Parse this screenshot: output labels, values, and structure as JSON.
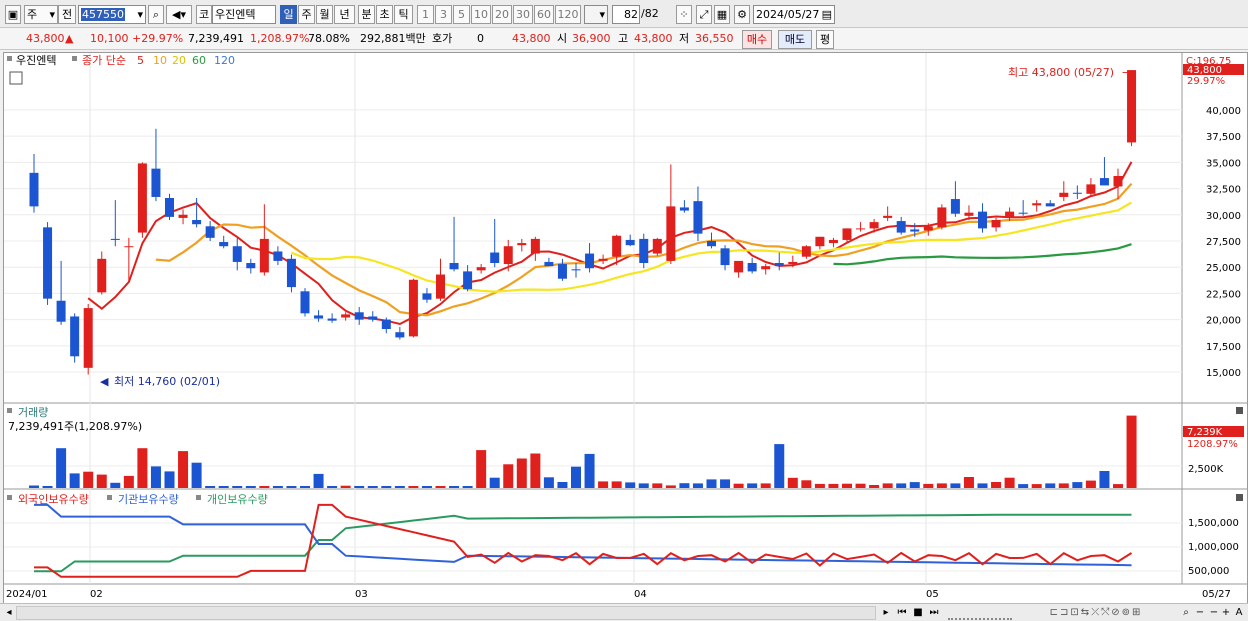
{
  "toolbar": {
    "market": "주",
    "prev": "전",
    "code": "457550",
    "kind": "코",
    "name": "우진엔텍",
    "periods": [
      "일",
      "주",
      "월",
      "년",
      "분",
      "초",
      "틱"
    ],
    "minutes": [
      "1",
      "3",
      "5",
      "10",
      "20",
      "30",
      "60",
      "120"
    ],
    "count": "82",
    "count_total": "/82",
    "date": "2024/05/27"
  },
  "info": {
    "price": "43,800",
    "change": "10,100",
    "change_pct": "+29.97%",
    "volume": "7,239,491",
    "volume_pct": "1,208.97%",
    "turnover": "78.08%",
    "amount": "292,881백만",
    "hoga_label": "호가",
    "hoga_value": "0",
    "hoga_price": "43,800",
    "open_label": "시",
    "open": "36,900",
    "high_label": "고",
    "high": "43,800",
    "low_label": "저",
    "low": "36,550",
    "buy": "매수",
    "sell": "매도",
    "avg": "평"
  },
  "price_panel": {
    "name": "우진엔텍",
    "ma_label": "종가 단순",
    "ma_periods": [
      "5",
      "10",
      "20",
      "60",
      "120"
    ],
    "ma_colors": [
      "#e0201c",
      "#f0a020",
      "#f0d020",
      "#2a9a40",
      "#3a7ad8"
    ],
    "ticks": [
      "40,000",
      "37,500",
      "35,000",
      "32,500",
      "30,000",
      "27,500",
      "25,000",
      "22,500",
      "20,000",
      "17,500",
      "15,000"
    ],
    "top_tick": "C:196.75",
    "current_tag": "43,800",
    "pct_tag": "29.97%",
    "high_annotation": "최고 43,800 (05/27)",
    "low_annotation": "최저 14,760 (02/01)"
  },
  "volume_panel": {
    "title": "거래량",
    "sub": "7,239,491주(1,208.97%)",
    "tick": "2,500K",
    "tag": "7,239K",
    "tag_pct": "1208.97%"
  },
  "holding_panel": {
    "legend": [
      {
        "label": "외국인보유수량",
        "color": "#e0201c"
      },
      {
        "label": "기관보유수량",
        "color": "#2f62d8"
      },
      {
        "label": "개인보유수량",
        "color": "#2a9a60"
      }
    ],
    "ticks": [
      "1,500,000",
      "1,000,000",
      "500,000"
    ]
  },
  "xaxis": {
    "labels": [
      "2024/01",
      "02",
      "03",
      "04",
      "05",
      "05/27"
    ]
  },
  "chart_data": {
    "type": "candlestick",
    "period": "daily",
    "y_range": [
      13000,
      44000
    ],
    "candles": [
      {
        "o": 34000,
        "h": 35800,
        "l": 30200,
        "c": 30800
      },
      {
        "o": 28800,
        "h": 29300,
        "l": 21400,
        "c": 22000
      },
      {
        "o": 21800,
        "h": 25600,
        "l": 19500,
        "c": 19800
      },
      {
        "o": 20300,
        "h": 20600,
        "l": 15900,
        "c": 16500
      },
      {
        "o": 15400,
        "h": 21500,
        "l": 14760,
        "c": 21100
      },
      {
        "o": 22600,
        "h": 26500,
        "l": 22400,
        "c": 25800
      },
      {
        "o": 27700,
        "h": 31400,
        "l": 27000,
        "c": 27600
      },
      {
        "o": 27000,
        "h": 27800,
        "l": 23600,
        "c": 27000
      },
      {
        "o": 28300,
        "h": 35000,
        "l": 27800,
        "c": 34900
      },
      {
        "o": 34400,
        "h": 38200,
        "l": 31300,
        "c": 31700
      },
      {
        "o": 31600,
        "h": 32000,
        "l": 29500,
        "c": 29800
      },
      {
        "o": 29700,
        "h": 30500,
        "l": 29100,
        "c": 30000
      },
      {
        "o": 29500,
        "h": 31600,
        "l": 28800,
        "c": 29100
      },
      {
        "o": 28900,
        "h": 29400,
        "l": 27500,
        "c": 27800
      },
      {
        "o": 27400,
        "h": 28000,
        "l": 26800,
        "c": 27000
      },
      {
        "o": 27000,
        "h": 27800,
        "l": 24700,
        "c": 25500
      },
      {
        "o": 25400,
        "h": 25800,
        "l": 24400,
        "c": 24900
      },
      {
        "o": 24500,
        "h": 31000,
        "l": 24200,
        "c": 27700
      },
      {
        "o": 26500,
        "h": 27000,
        "l": 25200,
        "c": 25600
      },
      {
        "o": 25800,
        "h": 26200,
        "l": 22600,
        "c": 23100
      },
      {
        "o": 22700,
        "h": 23000,
        "l": 20300,
        "c": 20600
      },
      {
        "o": 20400,
        "h": 20900,
        "l": 19800,
        "c": 20100
      },
      {
        "o": 20100,
        "h": 20600,
        "l": 19700,
        "c": 19900
      },
      {
        "o": 20200,
        "h": 20700,
        "l": 19900,
        "c": 20500
      },
      {
        "o": 20700,
        "h": 21200,
        "l": 19500,
        "c": 20000
      },
      {
        "o": 20300,
        "h": 20800,
        "l": 19800,
        "c": 20000
      },
      {
        "o": 20000,
        "h": 20200,
        "l": 18700,
        "c": 19100
      },
      {
        "o": 18800,
        "h": 19300,
        "l": 18100,
        "c": 18300
      },
      {
        "o": 18400,
        "h": 23900,
        "l": 18300,
        "c": 23800
      },
      {
        "o": 22500,
        "h": 23000,
        "l": 21600,
        "c": 21900
      },
      {
        "o": 22000,
        "h": 25800,
        "l": 21800,
        "c": 24300
      },
      {
        "o": 25400,
        "h": 29800,
        "l": 24600,
        "c": 24800
      },
      {
        "o": 24600,
        "h": 25200,
        "l": 22700,
        "c": 22900
      },
      {
        "o": 24700,
        "h": 25300,
        "l": 24400,
        "c": 25000
      },
      {
        "o": 26400,
        "h": 29600,
        "l": 25000,
        "c": 25400
      },
      {
        "o": 25300,
        "h": 27600,
        "l": 24600,
        "c": 27000
      },
      {
        "o": 27100,
        "h": 27700,
        "l": 26500,
        "c": 27300
      },
      {
        "o": 26300,
        "h": 27900,
        "l": 25600,
        "c": 27700
      },
      {
        "o": 25500,
        "h": 25900,
        "l": 25100,
        "c": 25100
      },
      {
        "o": 25300,
        "h": 25800,
        "l": 23700,
        "c": 23900
      },
      {
        "o": 24800,
        "h": 25400,
        "l": 24000,
        "c": 24700
      },
      {
        "o": 26300,
        "h": 27300,
        "l": 24500,
        "c": 24900
      },
      {
        "o": 25600,
        "h": 26200,
        "l": 25300,
        "c": 25800
      },
      {
        "o": 26000,
        "h": 28100,
        "l": 25200,
        "c": 28000
      },
      {
        "o": 27600,
        "h": 28100,
        "l": 27000,
        "c": 27100
      },
      {
        "o": 27700,
        "h": 28200,
        "l": 24900,
        "c": 25400
      },
      {
        "o": 26300,
        "h": 27800,
        "l": 26100,
        "c": 27700
      },
      {
        "o": 25600,
        "h": 34800,
        "l": 25300,
        "c": 30800
      },
      {
        "o": 30700,
        "h": 31400,
        "l": 30200,
        "c": 30400
      },
      {
        "o": 31300,
        "h": 32700,
        "l": 27500,
        "c": 28200
      },
      {
        "o": 27500,
        "h": 28300,
        "l": 26800,
        "c": 27000
      },
      {
        "o": 26800,
        "h": 27100,
        "l": 24700,
        "c": 25200
      },
      {
        "o": 24500,
        "h": 25500,
        "l": 24000,
        "c": 25600
      },
      {
        "o": 25400,
        "h": 25900,
        "l": 24400,
        "c": 24600
      },
      {
        "o": 24800,
        "h": 25300,
        "l": 24300,
        "c": 25100
      },
      {
        "o": 25400,
        "h": 26400,
        "l": 24700,
        "c": 25100
      },
      {
        "o": 25300,
        "h": 26100,
        "l": 25000,
        "c": 25500
      },
      {
        "o": 26000,
        "h": 27100,
        "l": 25800,
        "c": 27000
      },
      {
        "o": 27000,
        "h": 27900,
        "l": 26700,
        "c": 27900
      },
      {
        "o": 27300,
        "h": 27800,
        "l": 26900,
        "c": 27600
      },
      {
        "o": 27600,
        "h": 28700,
        "l": 27300,
        "c": 28700
      },
      {
        "o": 28700,
        "h": 29300,
        "l": 28400,
        "c": 28700
      },
      {
        "o": 28700,
        "h": 29600,
        "l": 28300,
        "c": 29300
      },
      {
        "o": 29700,
        "h": 30800,
        "l": 29400,
        "c": 29900
      },
      {
        "o": 29400,
        "h": 29800,
        "l": 28100,
        "c": 28300
      },
      {
        "o": 28600,
        "h": 29200,
        "l": 27900,
        "c": 28400
      },
      {
        "o": 28500,
        "h": 29200,
        "l": 28000,
        "c": 28900
      },
      {
        "o": 28800,
        "h": 31000,
        "l": 28600,
        "c": 30700
      },
      {
        "o": 31500,
        "h": 33200,
        "l": 29800,
        "c": 30100
      },
      {
        "o": 29900,
        "h": 30900,
        "l": 29500,
        "c": 30200
      },
      {
        "o": 30300,
        "h": 31100,
        "l": 28300,
        "c": 28700
      },
      {
        "o": 28800,
        "h": 29700,
        "l": 28400,
        "c": 29500
      },
      {
        "o": 29700,
        "h": 30700,
        "l": 29400,
        "c": 30300
      },
      {
        "o": 30200,
        "h": 31400,
        "l": 29900,
        "c": 30100
      },
      {
        "o": 30900,
        "h": 31400,
        "l": 30300,
        "c": 31100
      },
      {
        "o": 31100,
        "h": 31400,
        "l": 30800,
        "c": 30800
      },
      {
        "o": 31700,
        "h": 33200,
        "l": 31300,
        "c": 32100
      },
      {
        "o": 32100,
        "h": 32800,
        "l": 31500,
        "c": 32000
      },
      {
        "o": 32000,
        "h": 33500,
        "l": 31800,
        "c": 32900
      },
      {
        "o": 33500,
        "h": 35500,
        "l": 33200,
        "c": 32800
      },
      {
        "o": 32700,
        "h": 34400,
        "l": 31500,
        "c": 33700
      },
      {
        "o": 36900,
        "h": 43800,
        "l": 36550,
        "c": 43800
      }
    ],
    "volume_k": [
      250,
      190,
      3980,
      1460,
      1630,
      1340,
      520,
      1210,
      3980,
      2160,
      1660,
      3690,
      2530,
      130,
      130,
      130,
      130,
      130,
      130,
      170,
      130,
      1410,
      130,
      230,
      150,
      130,
      130,
      120,
      130,
      120,
      120,
      110,
      100,
      3790,
      1030,
      2370,
      2950,
      3450,
      1070,
      600,
      2130,
      3410,
      660,
      660,
      560,
      460,
      460,
      260,
      480,
      460,
      860,
      860,
      430,
      460,
      460,
      4390,
      1020,
      770,
      410,
      410,
      430,
      430,
      300,
      460,
      460,
      590,
      410,
      460,
      460,
      1100,
      460,
      600,
      1030,
      390,
      390,
      460,
      460,
      590,
      740,
      1700,
      390,
      7239
    ],
    "ma_window_periods": [
      5,
      10,
      20,
      60,
      120
    ],
    "holdings_series": [
      {
        "name": "외국인보유수량",
        "start": 400000,
        "peak": 2000000,
        "end": 640000
      },
      {
        "name": "기관보유수량",
        "start": 2000000,
        "end": 420000
      },
      {
        "name": "개인보유수량",
        "start": 300000,
        "end": 1750000
      }
    ]
  }
}
